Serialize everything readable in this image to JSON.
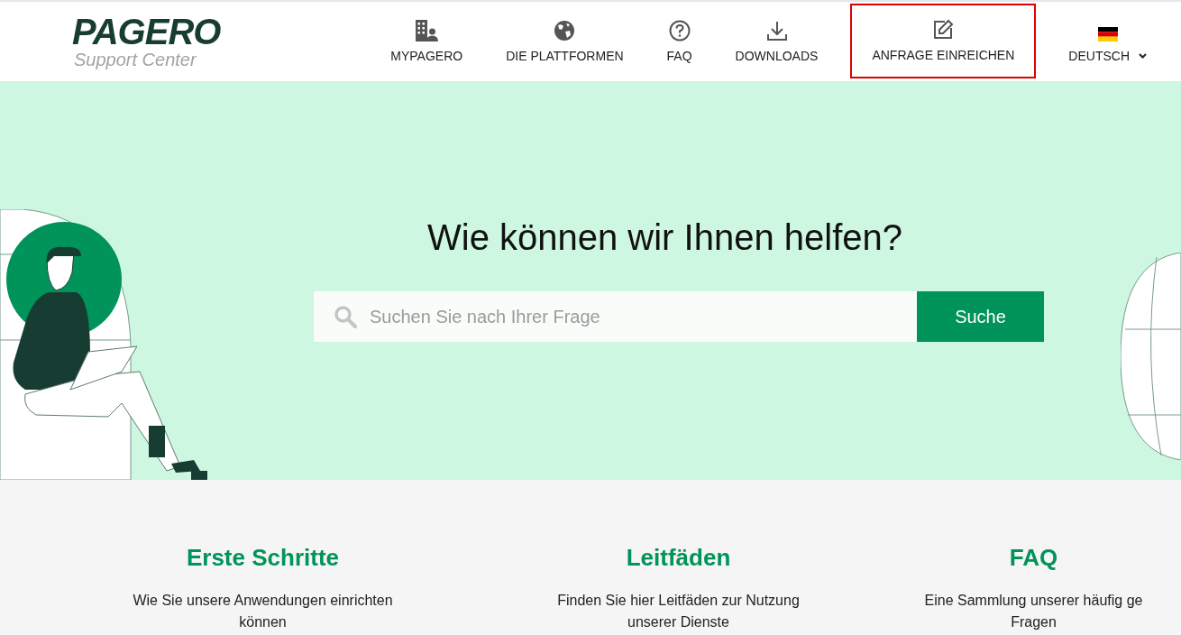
{
  "logo": {
    "wordmark": "PAGERO",
    "subtitle": "Support Center"
  },
  "nav": [
    {
      "label": "MYPAGERO",
      "kind": "building",
      "highlighted": false
    },
    {
      "label": "DIE PLATTFORMEN",
      "kind": "globe",
      "highlighted": false
    },
    {
      "label": "FAQ",
      "kind": "question",
      "highlighted": false
    },
    {
      "label": "DOWNLOADS",
      "kind": "download",
      "highlighted": false
    },
    {
      "label": "ANFRAGE EINREICHEN",
      "kind": "edit",
      "highlighted": true
    },
    {
      "label": "DEUTSCH",
      "kind": "language",
      "highlighted": false,
      "dropdown": true
    }
  ],
  "hero": {
    "heading": "Wie können wir Ihnen helfen?",
    "search": {
      "placeholder": "Suchen Sie nach Ihrer Frage",
      "button": "Suche"
    }
  },
  "cards": [
    {
      "title": "Erste Schritte",
      "description": [
        "Wie Sie unsere Anwendungen einrichten",
        "können"
      ]
    },
    {
      "title": "Leitfäden",
      "description": [
        "Finden Sie hier Leitfäden zur Nutzung",
        "unserer Dienste"
      ]
    },
    {
      "title": "FAQ",
      "description": [
        "Eine Sammlung unserer häufig ge",
        "Fragen"
      ]
    }
  ]
}
